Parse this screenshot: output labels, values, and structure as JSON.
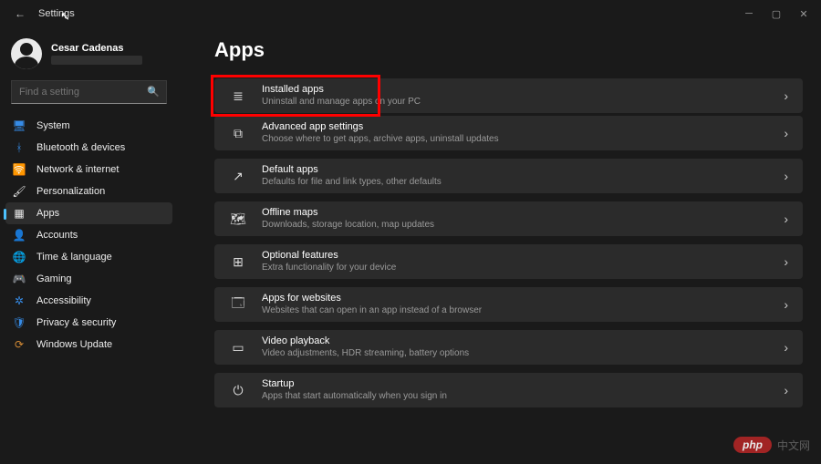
{
  "window": {
    "title": "Settings"
  },
  "user": {
    "name": "Cesar Cadenas"
  },
  "search": {
    "placeholder": "Find a setting"
  },
  "nav": {
    "items": [
      {
        "label": "System",
        "icon": "🖥",
        "iconClass": "ic-blue",
        "name": "sidebar-item-system"
      },
      {
        "label": "Bluetooth & devices",
        "icon": "ᚼ",
        "iconClass": "ic-blue",
        "name": "sidebar-item-bluetooth"
      },
      {
        "label": "Network & internet",
        "icon": "🛜",
        "iconClass": "ic-cyan",
        "name": "sidebar-item-network"
      },
      {
        "label": "Personalization",
        "icon": "🖌",
        "iconClass": "ic-white",
        "name": "sidebar-item-personalization"
      },
      {
        "label": "Apps",
        "icon": "▦",
        "iconClass": "ic-white",
        "name": "sidebar-item-apps",
        "selected": true
      },
      {
        "label": "Accounts",
        "icon": "👤",
        "iconClass": "ic-teal",
        "name": "sidebar-item-accounts"
      },
      {
        "label": "Time & language",
        "icon": "🌐",
        "iconClass": "ic-teal",
        "name": "sidebar-item-time-language"
      },
      {
        "label": "Gaming",
        "icon": "🎮",
        "iconClass": "ic-mag",
        "name": "sidebar-item-gaming"
      },
      {
        "label": "Accessibility",
        "icon": "✲",
        "iconClass": "ic-blue",
        "name": "sidebar-item-accessibility"
      },
      {
        "label": "Privacy & security",
        "icon": "🛡",
        "iconClass": "ic-blue",
        "name": "sidebar-item-privacy"
      },
      {
        "label": "Windows Update",
        "icon": "⟳",
        "iconClass": "ic-orange",
        "name": "sidebar-item-update"
      }
    ]
  },
  "page": {
    "title": "Apps",
    "cards": [
      {
        "title": "Installed apps",
        "sub": "Uninstall and manage apps on your PC",
        "icon": "≣",
        "name": "card-installed-apps",
        "highlight": true
      },
      {
        "title": "Advanced app settings",
        "sub": "Choose where to get apps, archive apps, uninstall updates",
        "icon": "⧉",
        "name": "card-advanced-settings"
      },
      {
        "title": "Default apps",
        "sub": "Defaults for file and link types, other defaults",
        "icon": "↗",
        "name": "card-default-apps",
        "gap": true
      },
      {
        "title": "Offline maps",
        "sub": "Downloads, storage location, map updates",
        "icon": "🗺",
        "name": "card-offline-maps",
        "gap": true
      },
      {
        "title": "Optional features",
        "sub": "Extra functionality for your device",
        "icon": "⊞",
        "name": "card-optional-features",
        "gap": true
      },
      {
        "title": "Apps for websites",
        "sub": "Websites that can open in an app instead of a browser",
        "icon": "🗔",
        "name": "card-apps-for-websites",
        "gap": true
      },
      {
        "title": "Video playback",
        "sub": "Video adjustments, HDR streaming, battery options",
        "icon": "▭",
        "name": "card-video-playback",
        "gap": true
      },
      {
        "title": "Startup",
        "sub": "Apps that start automatically when you sign in",
        "icon": "⏻",
        "name": "card-startup",
        "gap": true
      }
    ]
  },
  "watermark": {
    "pill": "php",
    "text": "中文网"
  }
}
